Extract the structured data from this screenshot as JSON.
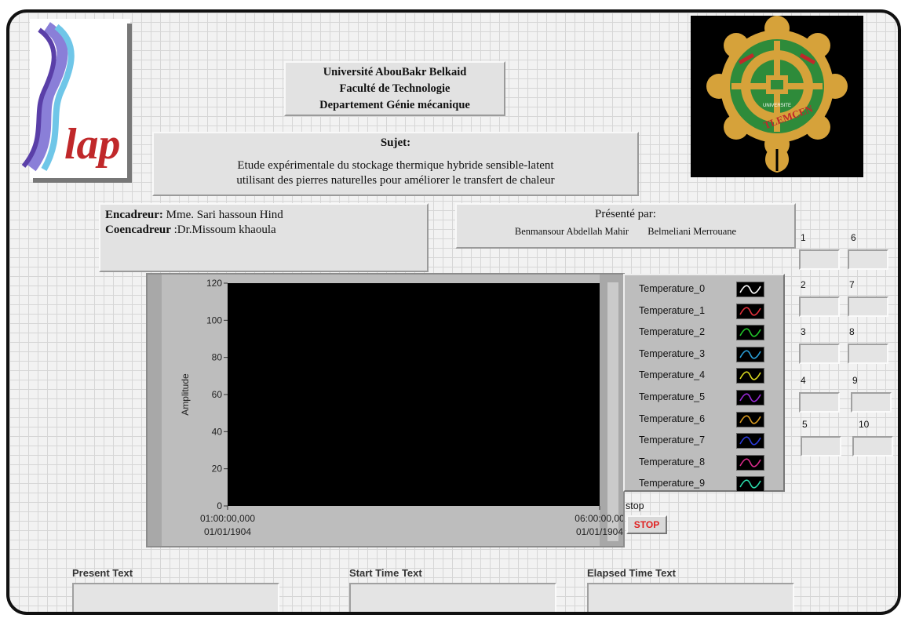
{
  "header": {
    "university": "Université AbouBakr Belkaid",
    "faculty": "Faculté de Technologie",
    "department": "Departement Génie mécanique"
  },
  "logos": {
    "left_logo_text": "lap",
    "right_logo_text": "TLEMCEN",
    "right_logo_small_text": "UNIVERSITE"
  },
  "subject": {
    "title": "Sujet:",
    "line1": "Etude expérimentale du stockage thermique hybride sensible-latent",
    "line2": "utilisant des pierres naturelles pour améliorer le transfert de chaleur"
  },
  "supervisors": {
    "encadreur_label": "Encadreur:",
    "encadreur_name": " Mme. Sari hassoun Hind",
    "coencadreur_label": "Coencadreur",
    "coencadreur_name": " :Dr.Missoum khaoula"
  },
  "presenters": {
    "title": "Présenté par:",
    "student1": "Benmansour Abdellah Mahir",
    "student2": "Belmeliani Merrouane"
  },
  "indicators": [
    "1",
    "2",
    "3",
    "4",
    "5",
    "6",
    "7",
    "8",
    "9",
    "10"
  ],
  "chart_data": {
    "type": "line",
    "ylabel": "Amplitude",
    "ylim": [
      0,
      120
    ],
    "y_ticks": [
      "0",
      "20",
      "40",
      "60",
      "80",
      "100",
      "120"
    ],
    "x_start": [
      "01:00:00,000",
      "01/01/1904"
    ],
    "x_end": [
      "06:00:00,00",
      "01/01/1904"
    ],
    "series": [
      {
        "name": "Temperature_0",
        "color": "#ffffff",
        "values": []
      },
      {
        "name": "Temperature_1",
        "color": "#e0303a",
        "values": []
      },
      {
        "name": "Temperature_2",
        "color": "#22c52a",
        "values": []
      },
      {
        "name": "Temperature_3",
        "color": "#2a9fd8",
        "values": []
      },
      {
        "name": "Temperature_4",
        "color": "#d8d820",
        "values": []
      },
      {
        "name": "Temperature_5",
        "color": "#9a2ad8",
        "values": []
      },
      {
        "name": "Temperature_6",
        "color": "#d89a20",
        "values": []
      },
      {
        "name": "Temperature_7",
        "color": "#2a3ad8",
        "values": []
      },
      {
        "name": "Temperature_8",
        "color": "#d82a8a",
        "values": []
      },
      {
        "name": "Temperature_9",
        "color": "#2ad8a8",
        "values": []
      }
    ]
  },
  "stop": {
    "label": "stop",
    "button": "STOP"
  },
  "text_fields": {
    "present_label": "Present Text",
    "start_label": "Start Time Text",
    "elapsed_label": "Elapsed Time Text"
  }
}
